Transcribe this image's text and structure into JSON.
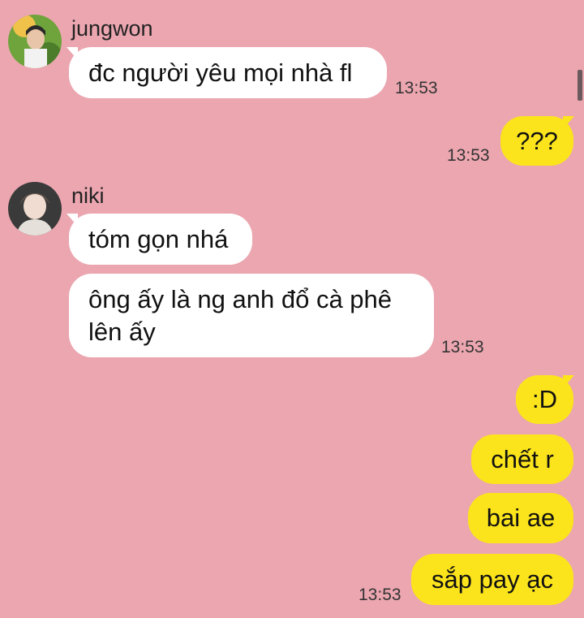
{
  "theme": {
    "background": "#eba6b0",
    "incoming_bubble": "#ffffff",
    "outgoing_bubble": "#fbe41c"
  },
  "messages": {
    "jungwon": {
      "name": "jungwon",
      "text": "đc người yêu mọi nhà fl",
      "time": "13:53"
    },
    "me_1": {
      "text": "???",
      "time": "13:53"
    },
    "niki": {
      "name": "niki",
      "text_1": "tóm gọn nhá",
      "text_2_line_1": "ông ấy là ng anh đổ cà phê",
      "text_2_line_2": "lên ấy",
      "time": "13:53"
    },
    "me_2": {
      "text_1": ":D",
      "text_2": "chết r",
      "text_3": "bai ae",
      "text_4": "sắp pay ạc",
      "time": "13:53"
    }
  }
}
